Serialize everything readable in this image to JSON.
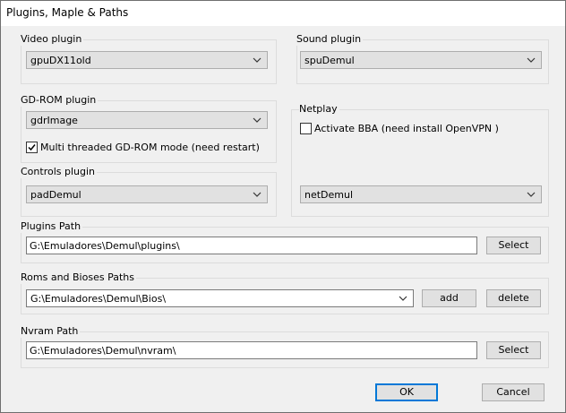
{
  "window": {
    "title": "Plugins, Maple & Paths"
  },
  "video_plugin": {
    "label": "Video plugin",
    "selected": "gpuDX11old"
  },
  "sound_plugin": {
    "label": "Sound plugin",
    "selected": "spuDemul"
  },
  "gdrom_plugin": {
    "label": "GD-ROM plugin",
    "selected": "gdrImage",
    "multithread_label": "Multi threaded GD-ROM mode (need restart)",
    "multithread_checked": true
  },
  "netplay": {
    "label": "Netplay",
    "bba_label": "Activate BBA (need install OpenVPN )",
    "bba_checked": false,
    "selected": "netDemul"
  },
  "controls_plugin": {
    "label": "Controls plugin",
    "selected": "padDemul"
  },
  "plugins_path": {
    "label": "Plugins Path",
    "value": "G:\\Emuladores\\Demul\\plugins\\",
    "select_label": "Select"
  },
  "roms_paths": {
    "label": "Roms and Bioses Paths",
    "selected": "G:\\Emuladores\\Demul\\Bios\\",
    "add_label": "add",
    "delete_label": "delete"
  },
  "nvram_path": {
    "label": "Nvram Path",
    "value": "G:\\Emuladores\\Demul\\nvram\\",
    "select_label": "Select"
  },
  "footer": {
    "ok_label": "OK",
    "cancel_label": "Cancel"
  }
}
